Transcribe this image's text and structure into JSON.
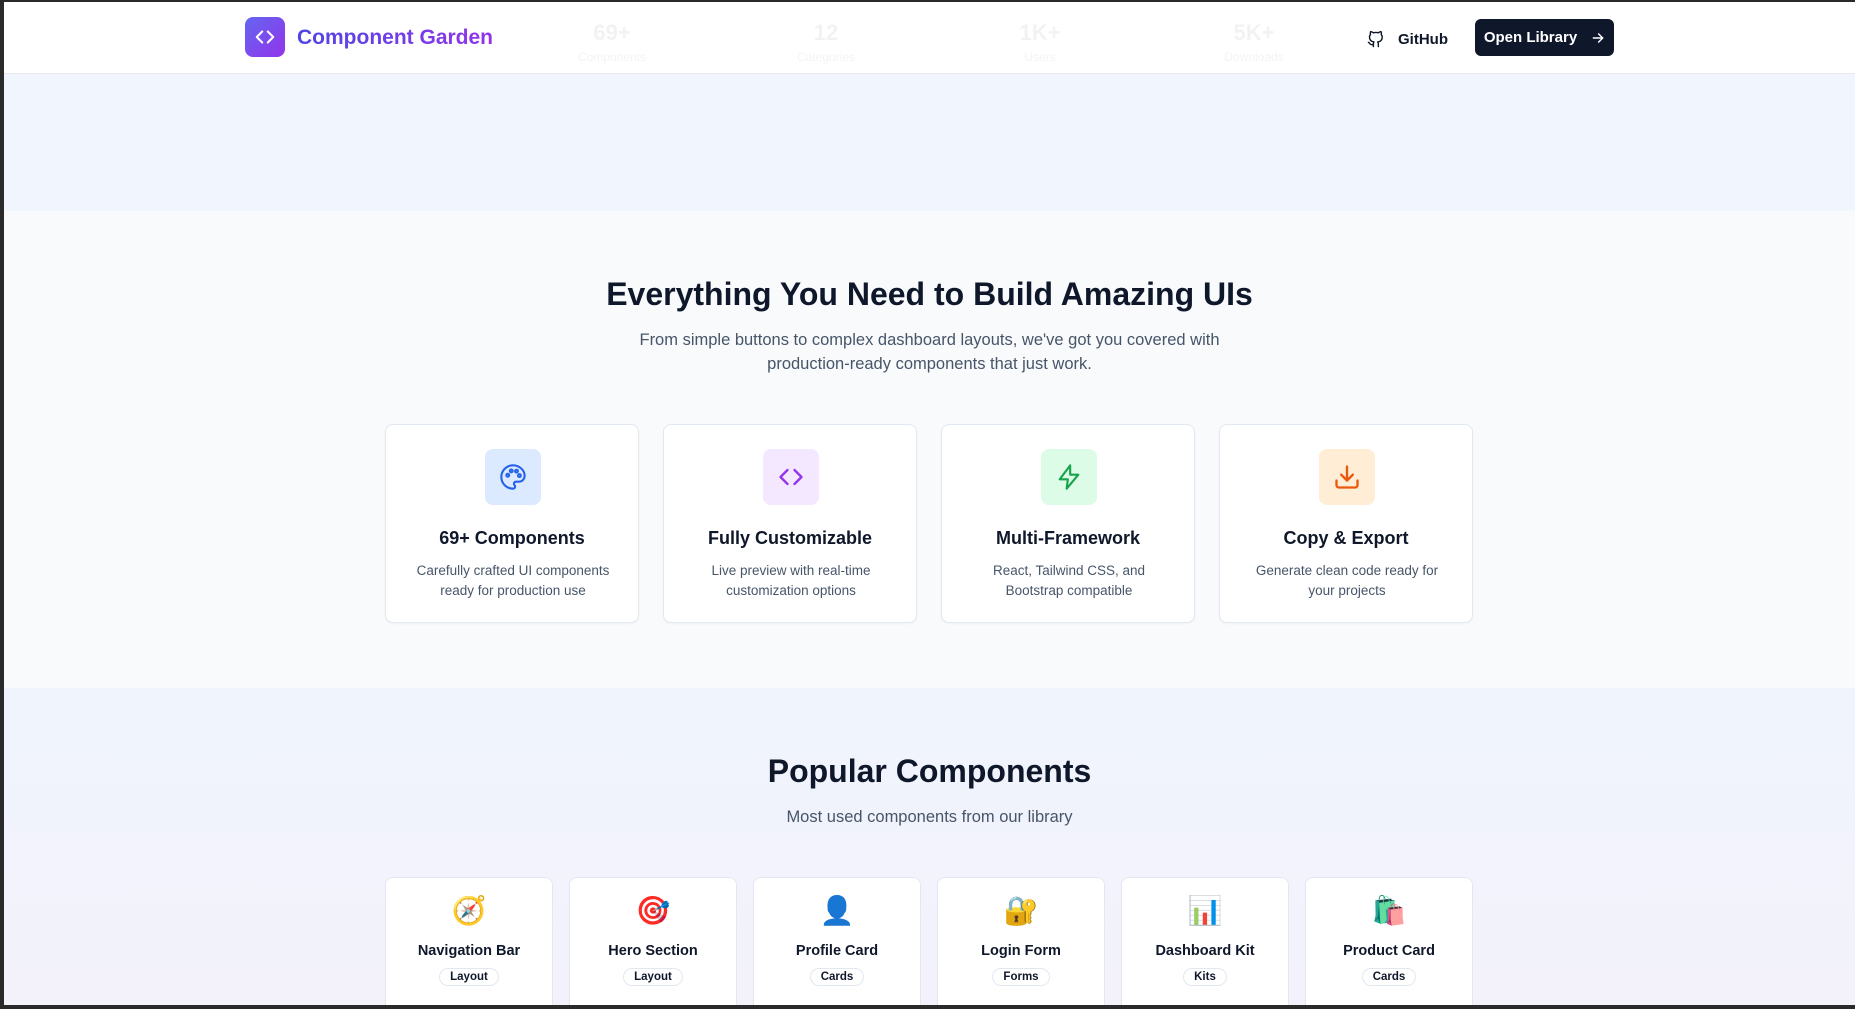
{
  "header": {
    "brand": "Component Garden",
    "ghost_stats": [
      {
        "value": "69+",
        "label": "Components"
      },
      {
        "value": "12",
        "label": "Categories"
      },
      {
        "value": "1K+",
        "label": "Users"
      },
      {
        "value": "5K+",
        "label": "Downloads"
      }
    ],
    "github_label": "GitHub",
    "open_library_label": "Open Library"
  },
  "features": {
    "title": "Everything You Need to Build Amazing UIs",
    "subtitle": "From simple buttons to complex dashboard layouts, we've got you covered with production-ready components that just work.",
    "cards": [
      {
        "icon": "palette-icon",
        "title": "69+ Components",
        "desc": "Carefully crafted UI components ready for production use",
        "color": "#2563eb",
        "bg": "#dbeafe"
      },
      {
        "icon": "code-icon",
        "title": "Fully Customizable",
        "desc": "Live preview with real-time customization options",
        "color": "#9333ea",
        "bg": "#f3e8ff"
      },
      {
        "icon": "zap-icon",
        "title": "Multi-Framework",
        "desc": "React, Tailwind CSS, and Bootstrap compatible",
        "color": "#16a34a",
        "bg": "#dcfce7"
      },
      {
        "icon": "download-icon",
        "title": "Copy & Export",
        "desc": "Generate clean code ready for your projects",
        "color": "#ea580c",
        "bg": "#ffedd5"
      }
    ]
  },
  "popular": {
    "title": "Popular Components",
    "subtitle": "Most used components from our library",
    "items": [
      {
        "emoji": "🧭",
        "name": "Navigation Bar",
        "tag": "Layout"
      },
      {
        "emoji": "🎯",
        "name": "Hero Section",
        "tag": "Layout"
      },
      {
        "emoji": "👤",
        "name": "Profile Card",
        "tag": "Cards"
      },
      {
        "emoji": "🔐",
        "name": "Login Form",
        "tag": "Forms"
      },
      {
        "emoji": "📊",
        "name": "Dashboard Kit",
        "tag": "Kits"
      },
      {
        "emoji": "🛍️",
        "name": "Product Card",
        "tag": "Cards"
      }
    ]
  }
}
